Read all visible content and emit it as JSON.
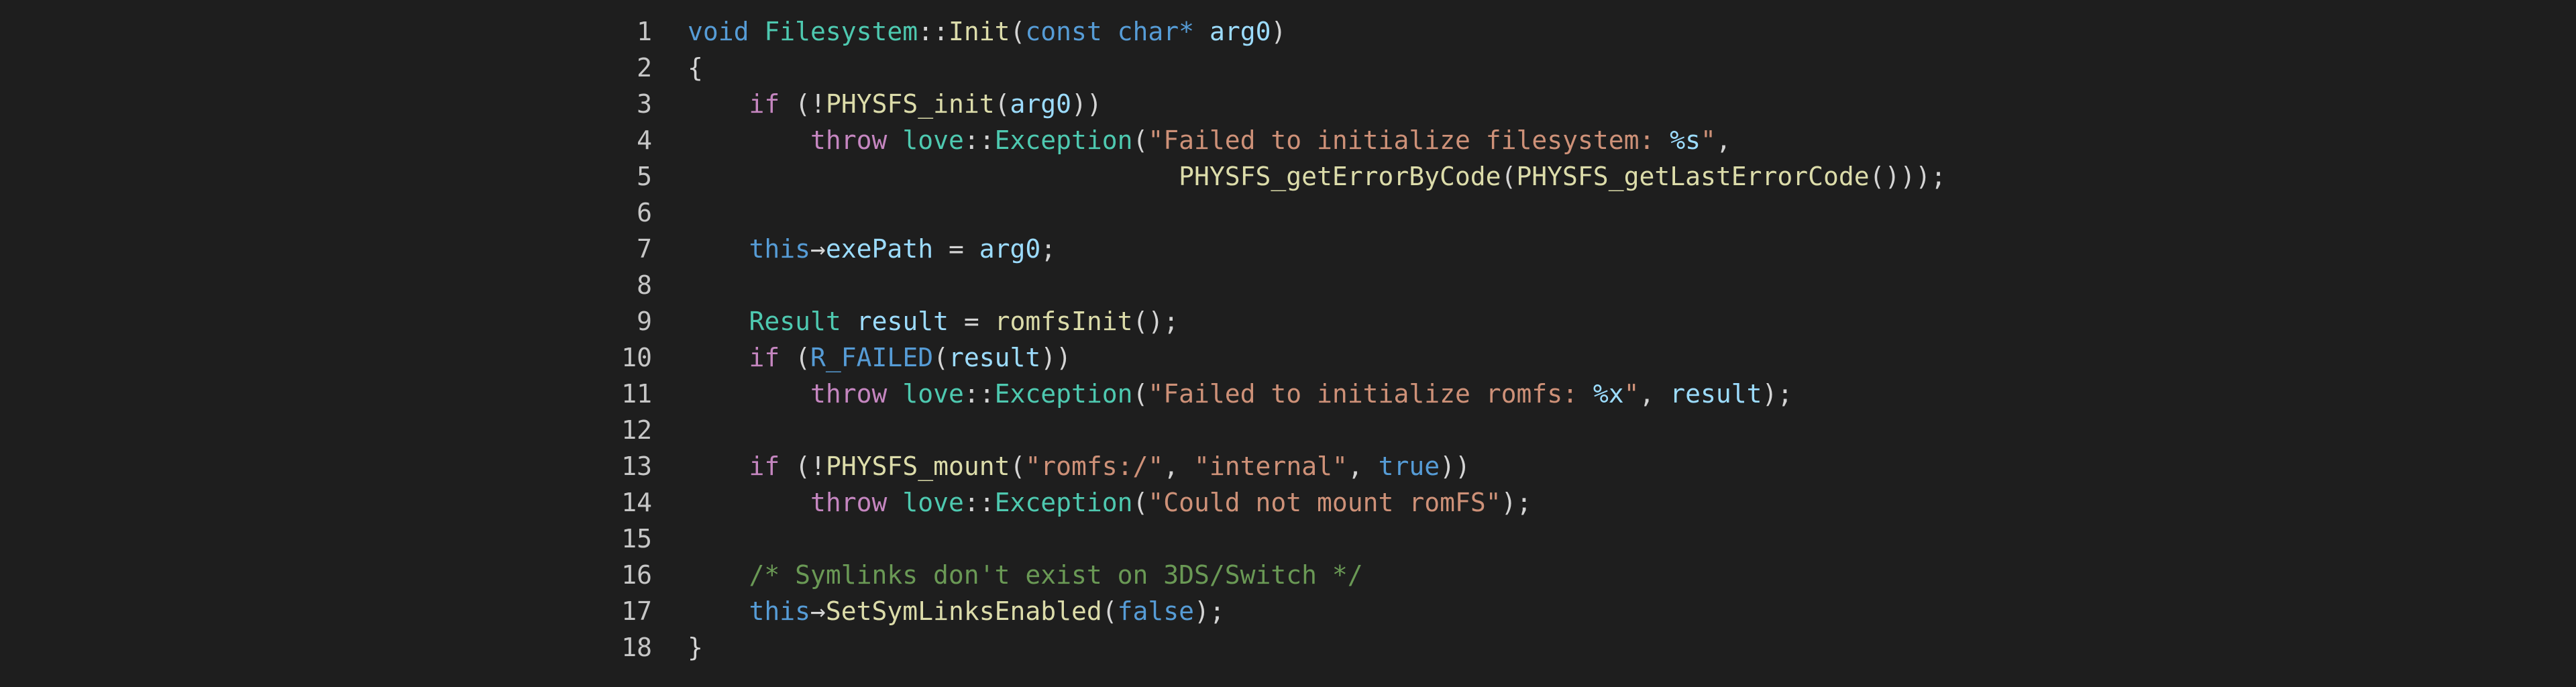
{
  "theme": {
    "background": "#1e1e1e",
    "line_number": "#c6c6c6",
    "default": "#d4d4d4",
    "keyword": "#569cd6",
    "control": "#c586c0",
    "type": "#4ec9b0",
    "function": "#dcdcaa",
    "variable": "#9cdcfe",
    "string": "#ce9178",
    "comment": "#6a9955"
  },
  "editor": {
    "lines": [
      {
        "number": "1",
        "tokens": [
          {
            "t": "void",
            "k": "kw"
          },
          {
            "t": " ",
            "k": "ws"
          },
          {
            "t": "Filesystem",
            "k": "type"
          },
          {
            "t": "::",
            "k": "op"
          },
          {
            "t": "Init",
            "k": "fn"
          },
          {
            "t": "(",
            "k": "punc"
          },
          {
            "t": "const",
            "k": "kw"
          },
          {
            "t": " ",
            "k": "ws"
          },
          {
            "t": "char",
            "k": "kw"
          },
          {
            "t": "*",
            "k": "kw"
          },
          {
            "t": " ",
            "k": "ws"
          },
          {
            "t": "arg0",
            "k": "var"
          },
          {
            "t": ")",
            "k": "punc"
          }
        ]
      },
      {
        "number": "2",
        "tokens": [
          {
            "t": "{",
            "k": "punc"
          }
        ]
      },
      {
        "number": "3",
        "tokens": [
          {
            "t": "    ",
            "k": "ws"
          },
          {
            "t": "if",
            "k": "ctrl"
          },
          {
            "t": " (",
            "k": "punc"
          },
          {
            "t": "!",
            "k": "op"
          },
          {
            "t": "PHYSFS_init",
            "k": "fn"
          },
          {
            "t": "(",
            "k": "punc"
          },
          {
            "t": "arg0",
            "k": "var"
          },
          {
            "t": "))",
            "k": "punc"
          }
        ]
      },
      {
        "number": "4",
        "tokens": [
          {
            "t": "        ",
            "k": "ws"
          },
          {
            "t": "throw",
            "k": "ctrl"
          },
          {
            "t": " ",
            "k": "ws"
          },
          {
            "t": "love",
            "k": "type"
          },
          {
            "t": "::",
            "k": "op"
          },
          {
            "t": "Exception",
            "k": "type"
          },
          {
            "t": "(",
            "k": "punc"
          },
          {
            "t": "\"Failed to initialize filesystem: ",
            "k": "str"
          },
          {
            "t": "%s",
            "k": "fmt"
          },
          {
            "t": "\"",
            "k": "str"
          },
          {
            "t": ",",
            "k": "punc"
          }
        ]
      },
      {
        "number": "5",
        "tokens": [
          {
            "t": "                                ",
            "k": "ws"
          },
          {
            "t": "PHYSFS_getErrorByCode",
            "k": "fn"
          },
          {
            "t": "(",
            "k": "punc"
          },
          {
            "t": "PHYSFS_getLastErrorCode",
            "k": "fn"
          },
          {
            "t": "()));",
            "k": "punc"
          }
        ]
      },
      {
        "number": "6",
        "tokens": []
      },
      {
        "number": "7",
        "tokens": [
          {
            "t": "    ",
            "k": "ws"
          },
          {
            "t": "this",
            "k": "kw"
          },
          {
            "t": "→",
            "k": "op"
          },
          {
            "t": "exePath",
            "k": "var"
          },
          {
            "t": " = ",
            "k": "op"
          },
          {
            "t": "arg0",
            "k": "var"
          },
          {
            "t": ";",
            "k": "punc"
          }
        ]
      },
      {
        "number": "8",
        "tokens": []
      },
      {
        "number": "9",
        "tokens": [
          {
            "t": "    ",
            "k": "ws"
          },
          {
            "t": "Result",
            "k": "type"
          },
          {
            "t": " ",
            "k": "ws"
          },
          {
            "t": "result",
            "k": "var"
          },
          {
            "t": " = ",
            "k": "op"
          },
          {
            "t": "romfsInit",
            "k": "fn"
          },
          {
            "t": "();",
            "k": "punc"
          }
        ]
      },
      {
        "number": "10",
        "tokens": [
          {
            "t": "    ",
            "k": "ws"
          },
          {
            "t": "if",
            "k": "ctrl"
          },
          {
            "t": " (",
            "k": "punc"
          },
          {
            "t": "R_FAILED",
            "k": "mac"
          },
          {
            "t": "(",
            "k": "punc"
          },
          {
            "t": "result",
            "k": "var"
          },
          {
            "t": "))",
            "k": "punc"
          }
        ]
      },
      {
        "number": "11",
        "tokens": [
          {
            "t": "        ",
            "k": "ws"
          },
          {
            "t": "throw",
            "k": "ctrl"
          },
          {
            "t": " ",
            "k": "ws"
          },
          {
            "t": "love",
            "k": "type"
          },
          {
            "t": "::",
            "k": "op"
          },
          {
            "t": "Exception",
            "k": "type"
          },
          {
            "t": "(",
            "k": "punc"
          },
          {
            "t": "\"Failed to initialize romfs: ",
            "k": "str"
          },
          {
            "t": "%x",
            "k": "fmt"
          },
          {
            "t": "\"",
            "k": "str"
          },
          {
            "t": ", ",
            "k": "punc"
          },
          {
            "t": "result",
            "k": "var"
          },
          {
            "t": ");",
            "k": "punc"
          }
        ]
      },
      {
        "number": "12",
        "tokens": []
      },
      {
        "number": "13",
        "tokens": [
          {
            "t": "    ",
            "k": "ws"
          },
          {
            "t": "if",
            "k": "ctrl"
          },
          {
            "t": " (",
            "k": "punc"
          },
          {
            "t": "!",
            "k": "op"
          },
          {
            "t": "PHYSFS_mount",
            "k": "fn"
          },
          {
            "t": "(",
            "k": "punc"
          },
          {
            "t": "\"romfs:/\"",
            "k": "str"
          },
          {
            "t": ", ",
            "k": "punc"
          },
          {
            "t": "\"internal\"",
            "k": "str"
          },
          {
            "t": ", ",
            "k": "punc"
          },
          {
            "t": "true",
            "k": "kw"
          },
          {
            "t": "))",
            "k": "punc"
          }
        ]
      },
      {
        "number": "14",
        "tokens": [
          {
            "t": "        ",
            "k": "ws"
          },
          {
            "t": "throw",
            "k": "ctrl"
          },
          {
            "t": " ",
            "k": "ws"
          },
          {
            "t": "love",
            "k": "type"
          },
          {
            "t": "::",
            "k": "op"
          },
          {
            "t": "Exception",
            "k": "type"
          },
          {
            "t": "(",
            "k": "punc"
          },
          {
            "t": "\"Could not mount romFS\"",
            "k": "str"
          },
          {
            "t": ");",
            "k": "punc"
          }
        ]
      },
      {
        "number": "15",
        "tokens": []
      },
      {
        "number": "16",
        "tokens": [
          {
            "t": "    ",
            "k": "ws"
          },
          {
            "t": "/* Symlinks don't exist on 3DS/Switch */",
            "k": "cm"
          }
        ]
      },
      {
        "number": "17",
        "tokens": [
          {
            "t": "    ",
            "k": "ws"
          },
          {
            "t": "this",
            "k": "kw"
          },
          {
            "t": "→",
            "k": "op"
          },
          {
            "t": "SetSymLinksEnabled",
            "k": "fn"
          },
          {
            "t": "(",
            "k": "punc"
          },
          {
            "t": "false",
            "k": "kw"
          },
          {
            "t": ");",
            "k": "punc"
          }
        ]
      },
      {
        "number": "18",
        "tokens": [
          {
            "t": "}",
            "k": "punc"
          }
        ]
      }
    ]
  }
}
